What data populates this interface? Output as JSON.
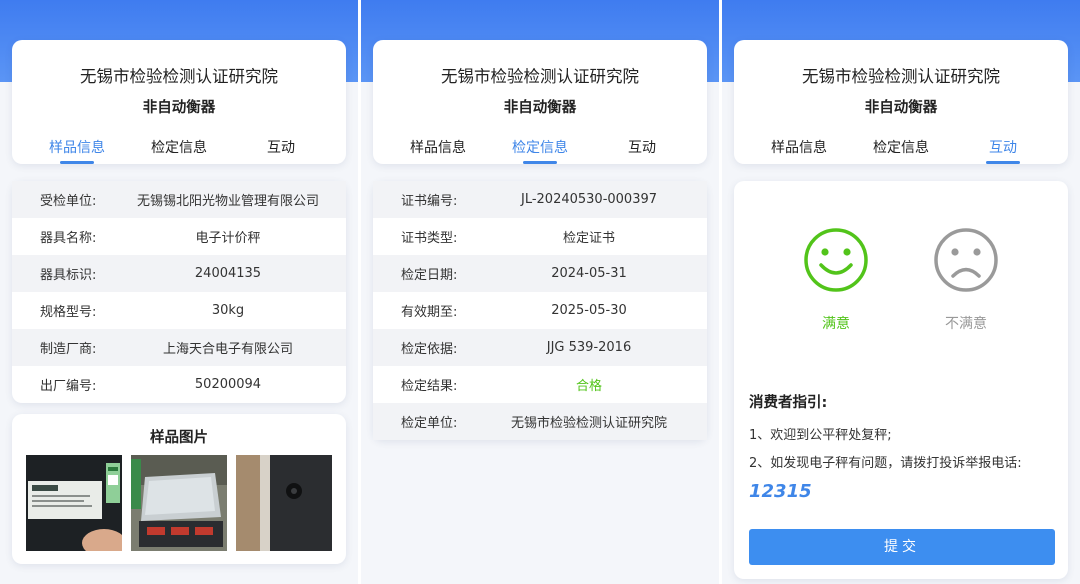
{
  "header": {
    "title": "无锡市检验检测认证研究院",
    "subtitle": "非自动衡器",
    "tabs": [
      "样品信息",
      "检定信息",
      "互动"
    ]
  },
  "sample_info": {
    "rows": [
      {
        "label": "受检单位:",
        "value": "无锡锡北阳光物业管理有限公司"
      },
      {
        "label": "器具名称:",
        "value": "电子计价秤"
      },
      {
        "label": "器具标识:",
        "value": "24004135"
      },
      {
        "label": "规格型号:",
        "value": "30kg"
      },
      {
        "label": "制造厂商:",
        "value": "上海天合电子有限公司"
      },
      {
        "label": "出厂编号:",
        "value": "50200094"
      }
    ],
    "pictures_title": "样品图片"
  },
  "verification_info": {
    "rows": [
      {
        "label": "证书编号:",
        "value": "JL-20240530-000397"
      },
      {
        "label": "证书类型:",
        "value": "检定证书"
      },
      {
        "label": "检定日期:",
        "value": "2024-05-31"
      },
      {
        "label": "有效期至:",
        "value": "2025-05-30"
      },
      {
        "label": "检定依据:",
        "value": "JJG 539-2016"
      },
      {
        "label": "检定结果:",
        "value": "合格",
        "color": "#52c41a"
      },
      {
        "label": "检定单位:",
        "value": "无锡市检验检测认证研究院"
      }
    ]
  },
  "interaction": {
    "satisfied_label": "满意",
    "unsatisfied_label": "不满意",
    "guide_title": "消费者指引:",
    "guide_lines": [
      "1、欢迎到公平秤处复秤;",
      "2、如发现电子秤有问题，请拨打投诉举报电话:"
    ],
    "phone": "12315",
    "submit_label": "提交"
  },
  "colors": {
    "accent": "#3f86e8",
    "pass": "#52c41a",
    "header_gradient": "#3f7cf0"
  }
}
